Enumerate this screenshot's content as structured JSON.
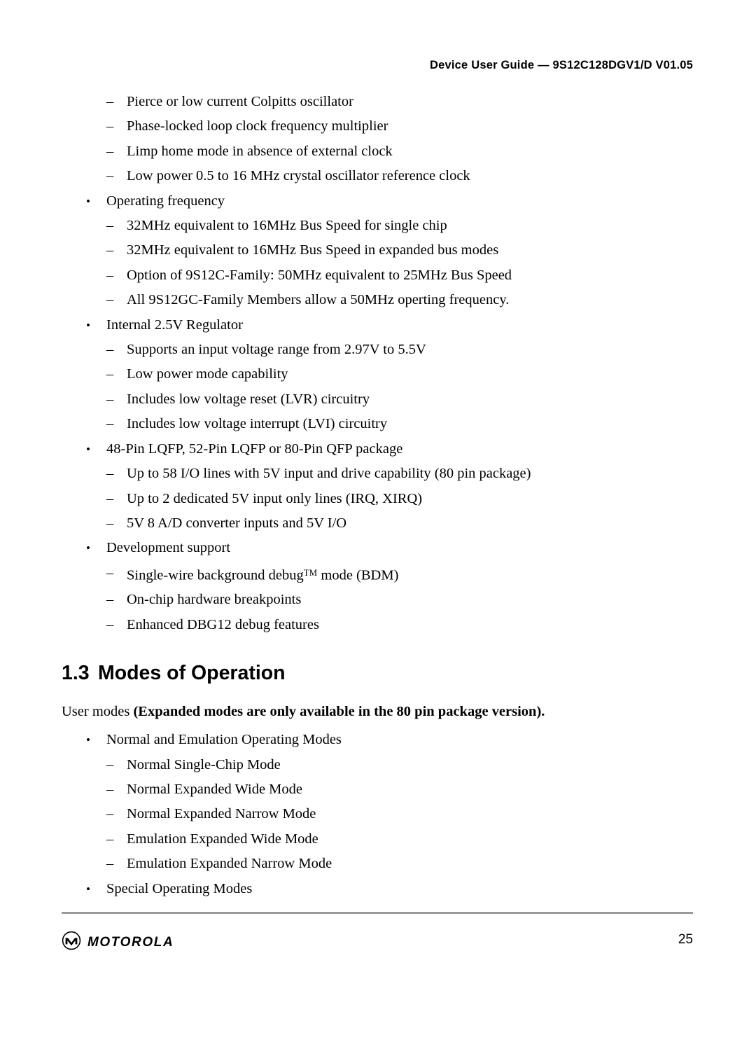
{
  "header": {
    "running_head": "Device User Guide — 9S12C128DGV1/D V01.05"
  },
  "body": {
    "items": [
      {
        "level": 2,
        "marker": "–",
        "text": "Pierce or low current Colpitts oscillator"
      },
      {
        "level": 2,
        "marker": "–",
        "text": "Phase-locked loop clock frequency multiplier"
      },
      {
        "level": 2,
        "marker": "–",
        "text": "Limp home mode in absence of external clock"
      },
      {
        "level": 2,
        "marker": "–",
        "text": "Low power 0.5 to 16 MHz crystal oscillator reference clock"
      },
      {
        "level": 1,
        "marker": "•",
        "text": "Operating frequency"
      },
      {
        "level": 2,
        "marker": "–",
        "text": "32MHz equivalent to 16MHz Bus Speed for single chip"
      },
      {
        "level": 2,
        "marker": "–",
        "text": "32MHz equivalent to 16MHz Bus Speed in expanded bus modes"
      },
      {
        "level": 2,
        "marker": "–",
        "text": "Option of 9S12C-Family: 50MHz equivalent to 25MHz Bus Speed"
      },
      {
        "level": 2,
        "marker": "–",
        "text": "All 9S12GC-Family Members allow a 50MHz operting frequency."
      },
      {
        "level": 1,
        "marker": "•",
        "text": "Internal 2.5V Regulator"
      },
      {
        "level": 2,
        "marker": "–",
        "text": "Supports an input voltage range from 2.97V to 5.5V"
      },
      {
        "level": 2,
        "marker": "–",
        "text": "Low power mode capability"
      },
      {
        "level": 2,
        "marker": "–",
        "text": "Includes low voltage reset (LVR) circuitry"
      },
      {
        "level": 2,
        "marker": "–",
        "text": "Includes low voltage interrupt (LVI) circuitry"
      },
      {
        "level": 1,
        "marker": "•",
        "text": "48-Pin LQFP, 52-Pin LQFP or 80-Pin QFP package"
      },
      {
        "level": 2,
        "marker": "–",
        "text": "Up to 58 I/O lines with 5V input and drive capability (80 pin package)"
      },
      {
        "level": 2,
        "marker": "–",
        "text": "Up to 2 dedicated 5V input only lines (IRQ, XIRQ)"
      },
      {
        "level": 2,
        "marker": "–",
        "text": "5V 8 A/D converter inputs and 5V I/O"
      },
      {
        "level": 1,
        "marker": "•",
        "text": "Development support"
      },
      {
        "level": 2,
        "marker": "–",
        "text_prefix": "Single-wire background debug",
        "superscript": "TM",
        "text_suffix": " mode (BDM)"
      },
      {
        "level": 2,
        "marker": "–",
        "text": "On-chip hardware breakpoints"
      },
      {
        "level": 2,
        "marker": "–",
        "text": "Enhanced DBG12 debug features"
      }
    ]
  },
  "section": {
    "number": "1.3",
    "title": "Modes of Operation",
    "intro_regular": "User modes ",
    "intro_bold": "(Expanded modes are only available in the 80 pin package version).",
    "items": [
      {
        "level": 1,
        "marker": "•",
        "text": "Normal and Emulation Operating Modes"
      },
      {
        "level": 2,
        "marker": "–",
        "text": "Normal Single-Chip Mode"
      },
      {
        "level": 2,
        "marker": "–",
        "text": "Normal Expanded Wide Mode"
      },
      {
        "level": 2,
        "marker": "–",
        "text": "Normal Expanded Narrow Mode"
      },
      {
        "level": 2,
        "marker": "–",
        "text": "Emulation Expanded Wide Mode"
      },
      {
        "level": 2,
        "marker": "–",
        "text": "Emulation Expanded Narrow Mode"
      },
      {
        "level": 1,
        "marker": "•",
        "text": "Special Operating Modes"
      }
    ]
  },
  "footer": {
    "logo_wordmark": "MOTOROLA",
    "page_number": "25",
    "rule_color": "#9a9a9a"
  }
}
